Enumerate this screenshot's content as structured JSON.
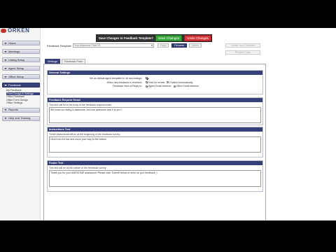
{
  "brand": {
    "logo_text": "ORKEN"
  },
  "sidebar": {
    "items": [
      {
        "label": "Home"
      },
      {
        "label": "Meetings"
      },
      {
        "label": "Listing Setup"
      },
      {
        "label": "Agent Setup"
      },
      {
        "label": "Office Setup"
      },
      {
        "label": "Feedback"
      },
      {
        "label": "Reports"
      },
      {
        "label": "Help and Training"
      }
    ],
    "feedback_sub": [
      "My Feedback",
      "Form Design & Settings",
      "Office Feedback",
      "Office Form Design",
      "Office Settings"
    ]
  },
  "dialog": {
    "question": "Save Changes to Feedback Template?",
    "save_label": "Save Changes",
    "undo_label": "Undo Changes"
  },
  "template": {
    "label": "Feedback Template",
    "selected": "Your Awesome Field V1",
    "copy_label": "Copy",
    "rename_label": "Rename",
    "delete_label": "Delete",
    "create_label": "Create New Template",
    "preview_label": "Preview Form"
  },
  "tabs": [
    {
      "label": "Settings"
    },
    {
      "label": "Feedback Form"
    }
  ],
  "general": {
    "header": "General Settings",
    "rows": [
      {
        "label": "Set as default agent template for all new listings:"
      },
      {
        "label": "When new feedback is received:",
        "opt1": "Hold for review",
        "opt2": "Publish Automatically"
      },
      {
        "label": "Feedback Sent to/Reply to:",
        "opt1": "Agent Email Address",
        "opt2": "Office Email Address"
      }
    ]
  },
  "request_email": {
    "header": "Feedback Request Email",
    "desc": "This text will be in the body of the feedback request email:",
    "text": "We know our listing is awesome, but how awesome was it to you?"
  },
  "instructions": {
    "header": "Instructions Text",
    "desc": "These instructions will be at the beginning of the feedback survey:",
    "text": "Click from the bar and move your way to the bottom"
  },
  "footer": {
    "header": "Footer Text",
    "desc": "This text will be at the bottom of the feedback survey:",
    "text": "Thank you for your AWESOME assistance! Please click 'Submit' below to send us your feedback :)"
  }
}
